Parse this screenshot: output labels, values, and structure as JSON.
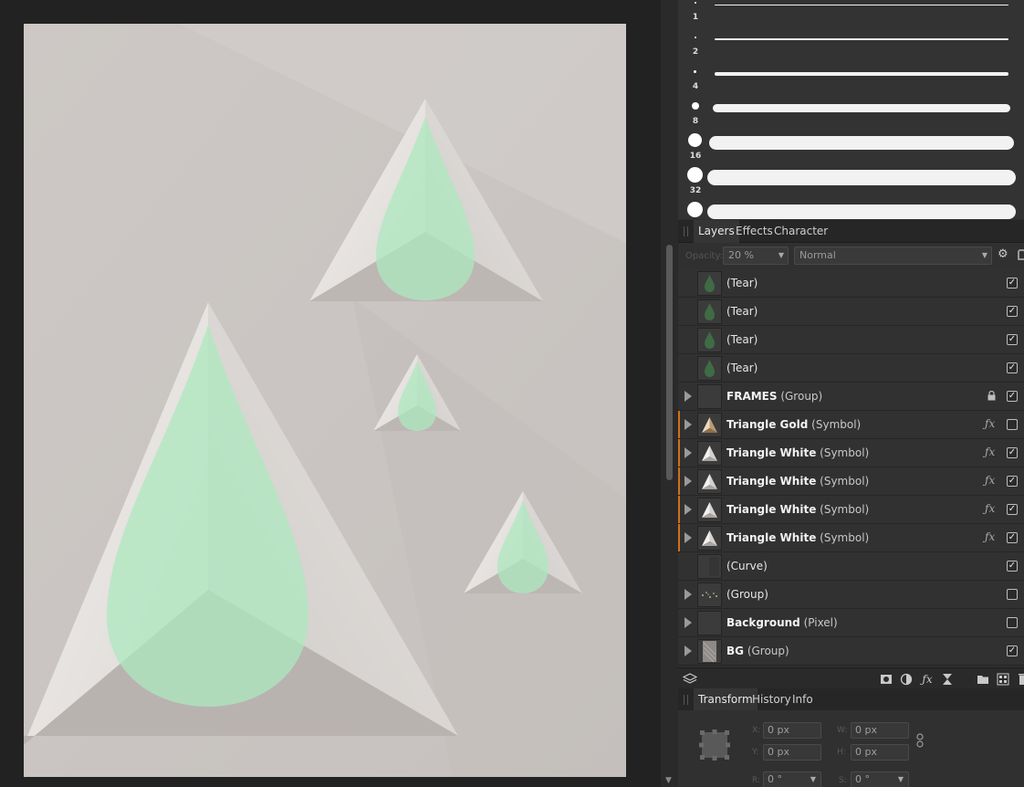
{
  "brushes": {
    "sizes": [
      "1",
      "2",
      "4",
      "8",
      "16",
      "32"
    ]
  },
  "panel_tabs_top": [
    "Layers",
    "Effects",
    "Character"
  ],
  "layers_options": {
    "opacity_label": "Opacity:",
    "opacity_value": "20 %",
    "blend_mode": "Normal"
  },
  "layers": [
    {
      "name": "(Tear)",
      "bold": false,
      "type": "",
      "expandable": false,
      "accent": false,
      "fx": false,
      "locked": false,
      "visible": true,
      "thumb": "tear"
    },
    {
      "name": "(Tear)",
      "bold": false,
      "type": "",
      "expandable": false,
      "accent": false,
      "fx": false,
      "locked": false,
      "visible": true,
      "thumb": "tear"
    },
    {
      "name": "(Tear)",
      "bold": false,
      "type": "",
      "expandable": false,
      "accent": false,
      "fx": false,
      "locked": false,
      "visible": true,
      "thumb": "tear"
    },
    {
      "name": "(Tear)",
      "bold": false,
      "type": "",
      "expandable": false,
      "accent": false,
      "fx": false,
      "locked": false,
      "visible": true,
      "thumb": "tear"
    },
    {
      "name": "FRAMES",
      "bold": true,
      "type": " (Group)",
      "expandable": true,
      "accent": false,
      "fx": false,
      "locked": true,
      "visible": true,
      "thumb": "empty"
    },
    {
      "name": "Triangle Gold",
      "bold": true,
      "type": " (Symbol)",
      "expandable": true,
      "accent": true,
      "fx": true,
      "locked": false,
      "visible": false,
      "thumb": "tri-gold"
    },
    {
      "name": "Triangle White",
      "bold": true,
      "type": " (Symbol)",
      "expandable": true,
      "accent": true,
      "fx": true,
      "locked": false,
      "visible": true,
      "thumb": "tri-white"
    },
    {
      "name": "Triangle White",
      "bold": true,
      "type": " (Symbol)",
      "expandable": true,
      "accent": true,
      "fx": true,
      "locked": false,
      "visible": true,
      "thumb": "tri-white"
    },
    {
      "name": "Triangle White",
      "bold": true,
      "type": " (Symbol)",
      "expandable": true,
      "accent": true,
      "fx": true,
      "locked": false,
      "visible": true,
      "thumb": "tri-white"
    },
    {
      "name": "Triangle White",
      "bold": true,
      "type": " (Symbol)",
      "expandable": true,
      "accent": true,
      "fx": true,
      "locked": false,
      "visible": true,
      "thumb": "tri-white"
    },
    {
      "name": "(Curve)",
      "bold": false,
      "type": "",
      "expandable": false,
      "accent": false,
      "fx": false,
      "locked": false,
      "visible": true,
      "thumb": "curve"
    },
    {
      "name": "(Group)",
      "bold": false,
      "type": "",
      "expandable": true,
      "accent": false,
      "fx": false,
      "locked": false,
      "visible": false,
      "thumb": "dots"
    },
    {
      "name": "Background",
      "bold": true,
      "type": " (Pixel)",
      "expandable": true,
      "accent": false,
      "fx": false,
      "locked": false,
      "visible": false,
      "thumb": "empty"
    },
    {
      "name": "BG",
      "bold": true,
      "type": " (Group)",
      "expandable": true,
      "accent": false,
      "fx": false,
      "locked": false,
      "visible": true,
      "thumb": "bg"
    }
  ],
  "panel_tabs_bottom": [
    "Transform",
    "History",
    "Info"
  ],
  "transform": {
    "x_label": "X:",
    "x_value": "0 px",
    "y_label": "Y:",
    "y_value": "0 px",
    "w_label": "W:",
    "w_value": "0 px",
    "h_label": "H:",
    "h_value": "0 px",
    "r_label": "R:",
    "r_value": "0 °",
    "s_label": "S:",
    "s_value": "0 °"
  },
  "colors": {
    "accent": "#d0701c",
    "tear": "#aee8bf",
    "paper": "#cbc6c3"
  }
}
